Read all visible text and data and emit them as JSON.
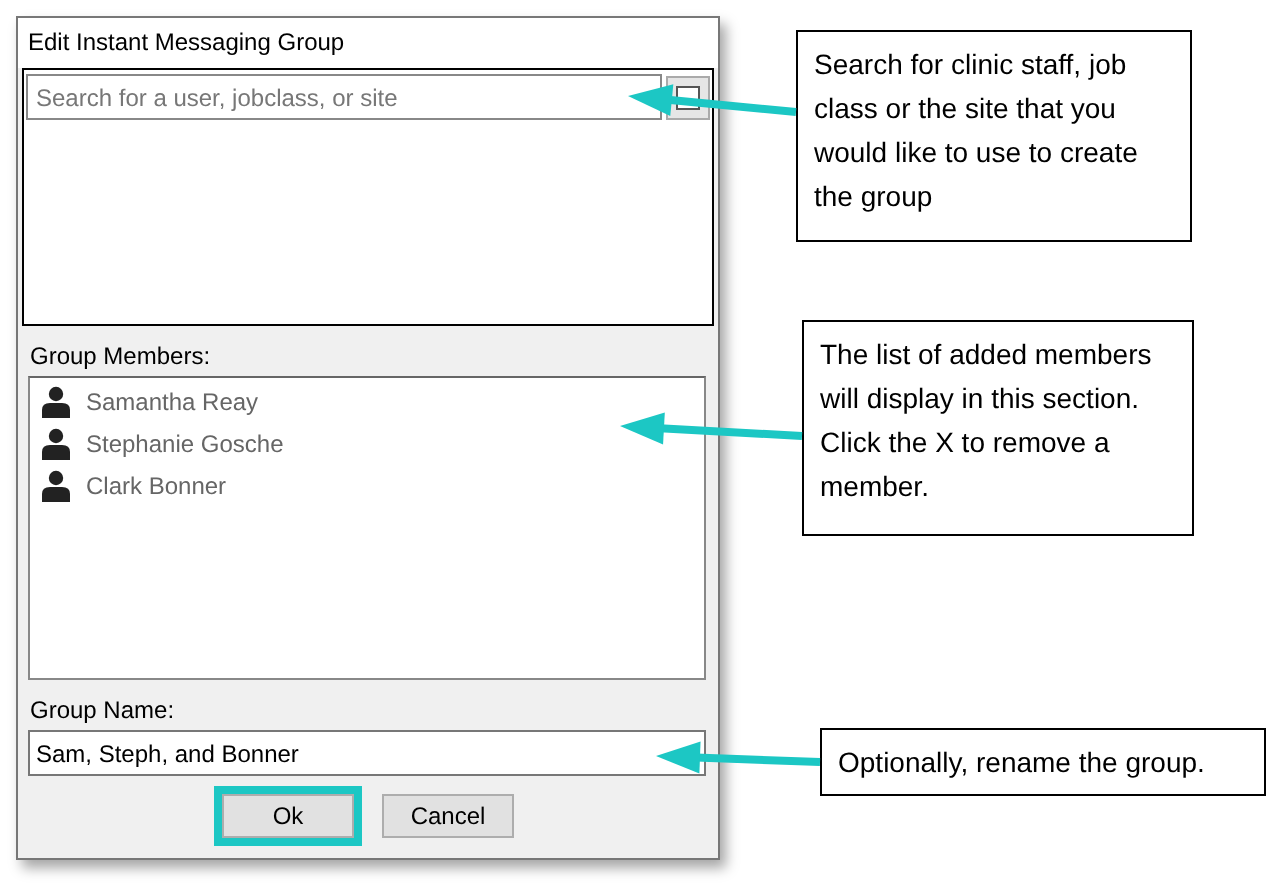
{
  "window": {
    "title": "Edit Instant Messaging Group"
  },
  "search": {
    "placeholder": "Search for a user, jobclass, or site"
  },
  "members_label": "Group Members:",
  "members": [
    {
      "name": "Samantha Reay"
    },
    {
      "name": "Stephanie Gosche"
    },
    {
      "name": "Clark Bonner"
    }
  ],
  "group_name": {
    "label": "Group Name:",
    "value": "Sam, Steph, and Bonner"
  },
  "buttons": [
    {
      "label": "Ok",
      "highlighted": true
    },
    {
      "label": "Cancel",
      "highlighted": false
    }
  ],
  "callouts": [
    {
      "text": "Search for clinic staff, job class or the site that you would like to use to create the group"
    },
    {
      "text": "The list of added members will display in this section. Click the X to remove a member."
    },
    {
      "text": "Optionally, rename the group."
    }
  ]
}
